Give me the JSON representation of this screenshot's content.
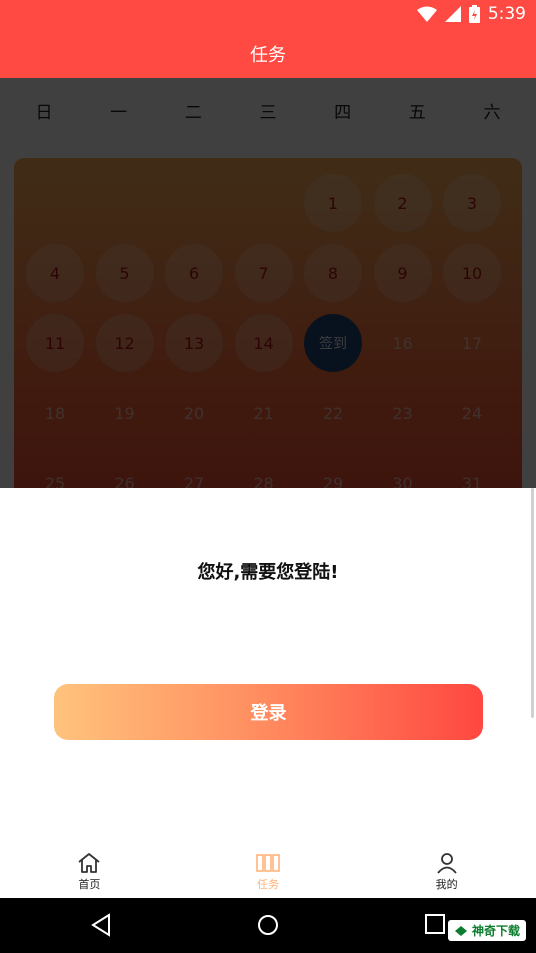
{
  "status_bar": {
    "time": "5:39"
  },
  "header": {
    "title": "任务"
  },
  "calendar": {
    "weekdays": [
      "日",
      "一",
      "二",
      "三",
      "四",
      "五",
      "六"
    ],
    "rows": [
      [
        "",
        "",
        "",
        "",
        "1",
        "2",
        "3"
      ],
      [
        "4",
        "5",
        "6",
        "7",
        "8",
        "9",
        "10"
      ],
      [
        "11",
        "12",
        "13",
        "14",
        "签到",
        "16",
        "17"
      ],
      [
        "18",
        "19",
        "20",
        "21",
        "22",
        "23",
        "24"
      ],
      [
        "25",
        "26",
        "27",
        "28",
        "29",
        "30",
        "31"
      ]
    ],
    "today_label": "签到"
  },
  "dialog": {
    "message": "您好,需要您登陆!",
    "login_label": "登录"
  },
  "tabbar": {
    "items": [
      {
        "label": "首页",
        "icon": "home-icon"
      },
      {
        "label": "任务",
        "icon": "task-icon",
        "active": true
      },
      {
        "label": "我的",
        "icon": "user-icon"
      }
    ]
  },
  "watermark": {
    "text": "神奇下载"
  },
  "colors": {
    "accent": "#ff4a43",
    "active_tab": "#ffb27a",
    "today": "#23457a"
  }
}
